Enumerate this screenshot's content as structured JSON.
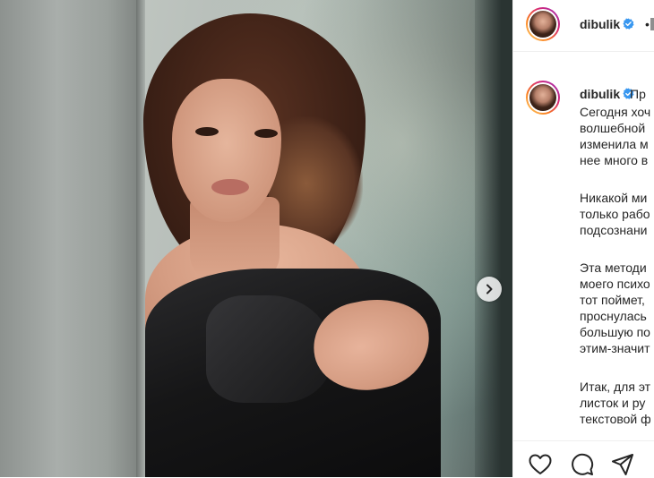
{
  "post": {
    "username": "dibulik",
    "separator": "•"
  },
  "caption": {
    "lines": [
      "Пр",
      "Сегодня хоч",
      "волшебной",
      "изменила м",
      "нее много в",
      "",
      "Никакой ми",
      "только рабо",
      "подсознани",
      "",
      "Эта методи",
      "моего психо",
      "тот поймет,",
      "проснулась",
      "большую по",
      "этим-значит",
      "",
      "Итак, для эт",
      "листок и ру",
      "текстовой ф"
    ]
  },
  "icons": {
    "verified": "verified-badge-icon",
    "next": "chevron-right-icon",
    "like": "heart-icon",
    "comment": "comment-icon",
    "share": "share-icon"
  },
  "colors": {
    "verified": "#3897f0",
    "text": "#262626"
  }
}
